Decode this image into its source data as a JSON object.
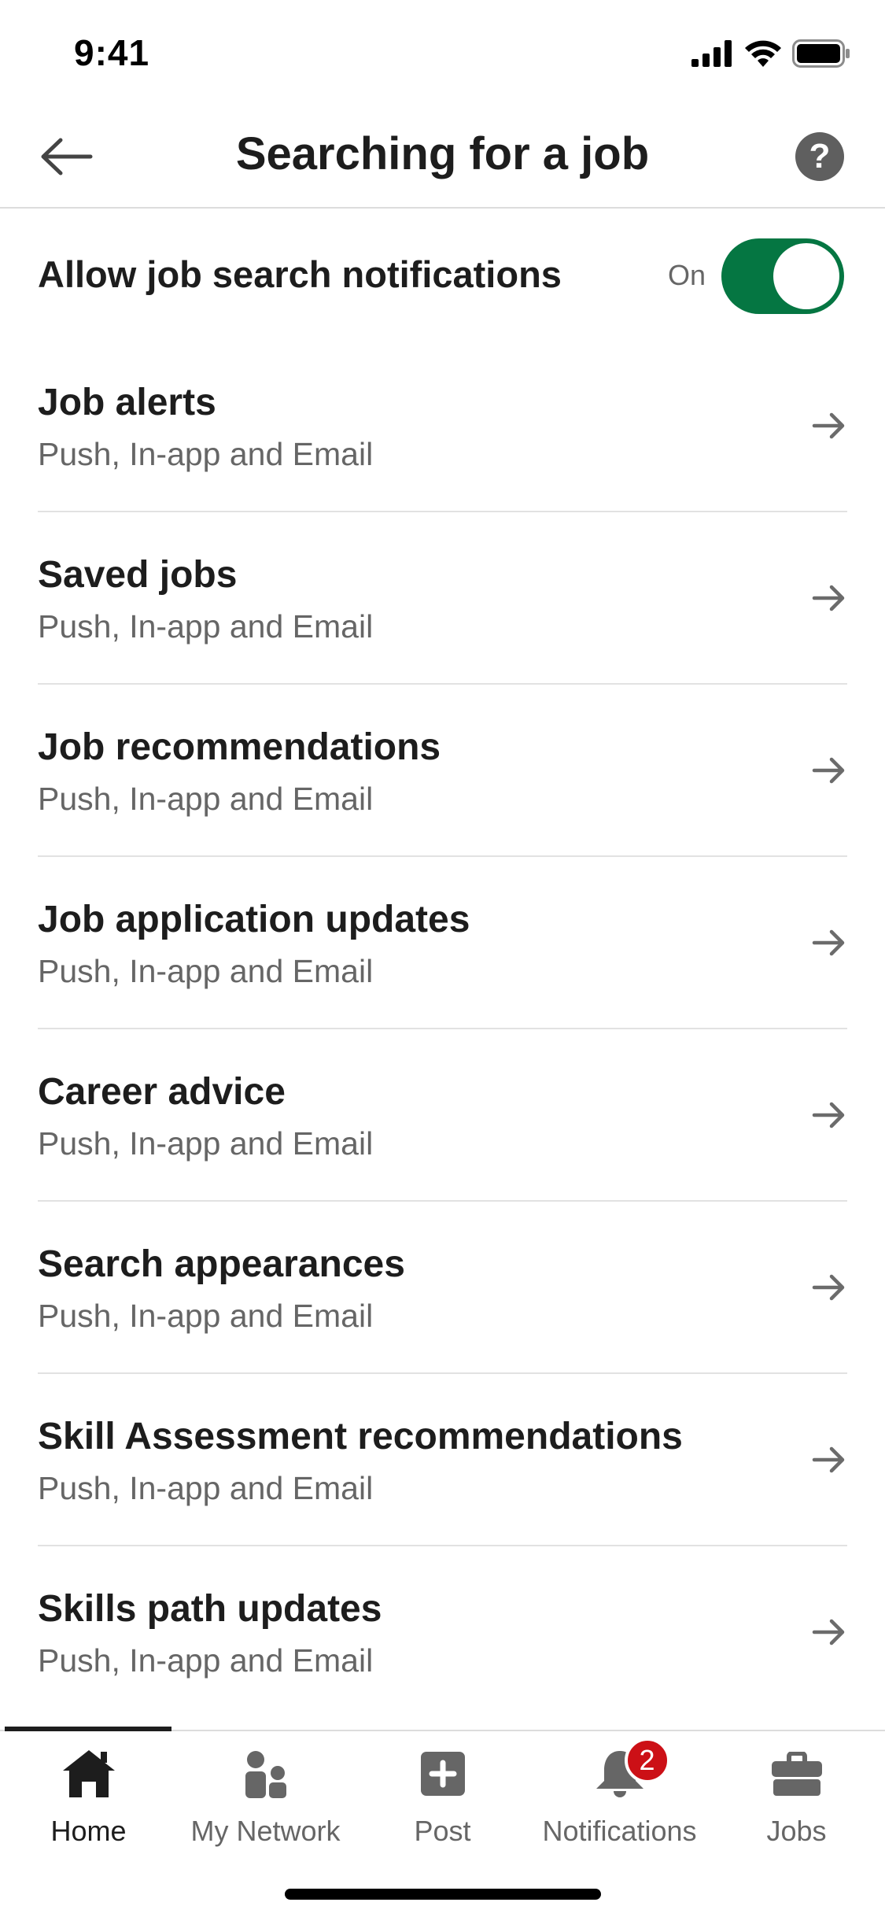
{
  "status_bar": {
    "time": "9:41"
  },
  "header": {
    "title": "Searching for a job",
    "help_label": "?"
  },
  "toggle": {
    "label": "Allow job search notifications",
    "state": "On"
  },
  "items": [
    {
      "title": "Job alerts",
      "subtitle": "Push, In-app and Email"
    },
    {
      "title": "Saved jobs",
      "subtitle": "Push, In-app and Email"
    },
    {
      "title": "Job recommendations",
      "subtitle": "Push, In-app and Email"
    },
    {
      "title": "Job application updates",
      "subtitle": "Push, In-app and Email"
    },
    {
      "title": "Career advice",
      "subtitle": "Push, In-app and Email"
    },
    {
      "title": "Search appearances",
      "subtitle": "Push, In-app and Email"
    },
    {
      "title": "Skill Assessment recommendations",
      "subtitle": "Push, In-app and Email"
    },
    {
      "title": "Skills path updates",
      "subtitle": "Push, In-app and Email"
    }
  ],
  "nav": {
    "home": "Home",
    "network": "My Network",
    "post": "Post",
    "notifications": "Notifications",
    "notifications_badge": "2",
    "jobs": "Jobs"
  },
  "colors": {
    "toggle_on": "#057642",
    "badge": "#cc1016",
    "icon_gray": "#666666"
  }
}
